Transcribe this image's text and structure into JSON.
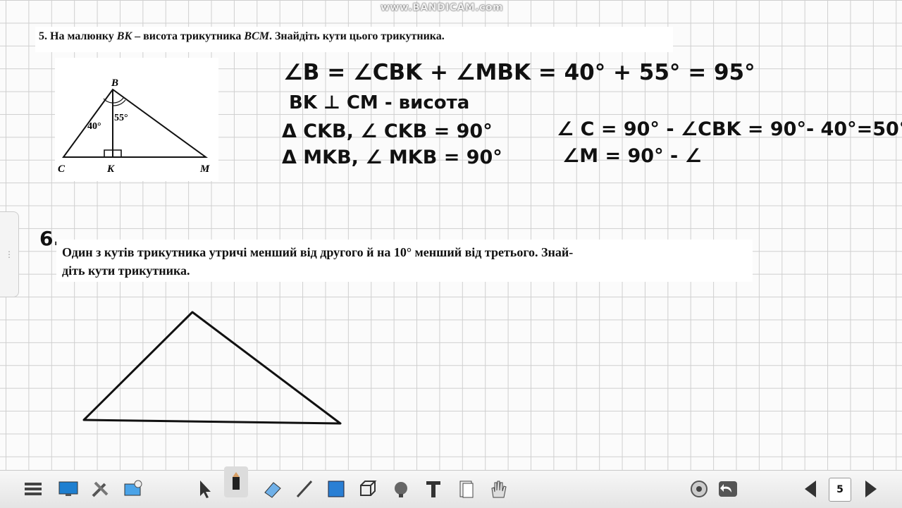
{
  "watermark": "www.BANDICAM.com",
  "task5": {
    "number": "5.",
    "text_a": "На малюнку ",
    "bk": "BK",
    "text_b": " – висота трикутника ",
    "bcm": "BCM",
    "text_c": ". Знайдіть кути цього трикутника.",
    "figure": {
      "label_b": "B",
      "label_c": "C",
      "label_k": "K",
      "label_m": "M",
      "angle_left": "40°",
      "angle_right": "55°"
    },
    "handwriting": {
      "line1": "∠B = ∠CBK + ∠MBK = 40° + 55° = 95°",
      "line2": "BK ⊥ CM - висота",
      "line3a": "Δ CKB,  ∠ CKB = 90°",
      "line3b": "∠ C = 90° - ∠CBK = 90°- 40°=50°",
      "line4a": "Δ MKB,  ∠ MKB = 90°",
      "line4b": "∠M = 90° - ∠"
    }
  },
  "task6": {
    "number": "6.",
    "line1": "Один з кутів трикутника утричі менший від другого й на 10° менший від третього. Знай-",
    "line2": "діть кути трикутника."
  },
  "toolbar": {
    "page_number": "5",
    "icons": [
      "menu-icon",
      "display-icon",
      "tools-icon",
      "gallery-icon",
      "select-arrow-icon",
      "pen-icon",
      "eraser-icon",
      "line-icon",
      "shape-icon",
      "3d-icon",
      "fill-icon",
      "text-icon",
      "page-icon",
      "hand-icon",
      "record-icon",
      "undo-icon",
      "prev-page-icon",
      "next-page-icon"
    ]
  },
  "colors": {
    "ink": "#111111",
    "grid": "#cfcfcf",
    "background": "#fbfbfb"
  }
}
